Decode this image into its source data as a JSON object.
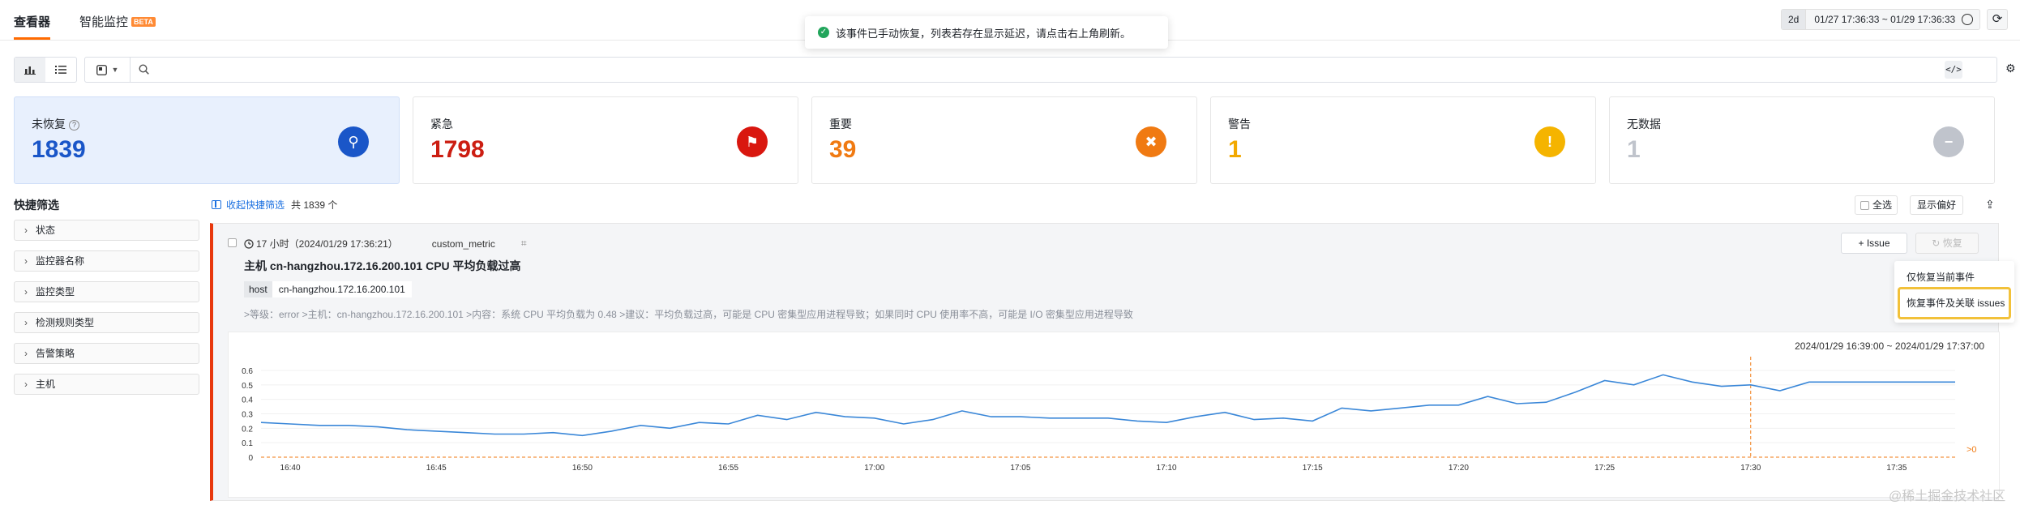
{
  "tabs": [
    {
      "label": "查看器"
    },
    {
      "label": "智能监控",
      "badge": "BETA"
    }
  ],
  "toast": {
    "message": "该事件已手动恢复，列表若存在显示延迟，请点击右上角刷新。"
  },
  "time": {
    "period": "2d",
    "range": "01/27 17:36:33 ~ 01/29 17:36:33"
  },
  "search": {
    "value": "",
    "code_label": "</>"
  },
  "cards": [
    {
      "label": "未恢复",
      "value": "1839",
      "color": "#1a56c8",
      "icon_color": "#1a56c8",
      "icon": "wrench-icon",
      "glyph": "⚲"
    },
    {
      "label": "紧急",
      "value": "1798",
      "color": "#cc1e12",
      "icon_color": "#d9170f",
      "icon": "siren-icon",
      "glyph": "⚑"
    },
    {
      "label": "重要",
      "value": "39",
      "color": "#f07a12",
      "icon_color": "#f07a12",
      "icon": "cross-icon",
      "glyph": "✖"
    },
    {
      "label": "警告",
      "value": "1",
      "color": "#f2a900",
      "icon_color": "#f5b400",
      "icon": "exclamation-icon",
      "glyph": "!"
    },
    {
      "label": "无数据",
      "value": "1",
      "color": "#c0c4cc",
      "icon_color": "#c0c4cc",
      "icon": "minus-icon",
      "glyph": "−"
    }
  ],
  "quick_filter": {
    "title": "快捷筛选",
    "items": [
      "状态",
      "监控器名称",
      "监控类型",
      "检测规则类型",
      "告警策略",
      "主机"
    ]
  },
  "list_header": {
    "collapse_label": "收起快捷筛选",
    "total_label": "共 1839 个",
    "select_all_label": "全选",
    "display_pref_label": "显示偏好"
  },
  "event": {
    "time_label": "17 小时（2024/01/29 17:36:21）",
    "metric": "custom_metric",
    "title": "主机 cn-hangzhou.172.16.200.101 CPU 平均负载过高",
    "tag_key": "host",
    "tag_value": "cn-hangzhou.172.16.200.101",
    "description": ">等级：error >主机：cn-hangzhou.172.16.200.101 >内容：系统 CPU 平均负载为 0.48 >建议：平均负载过高，可能是 CPU 密集型应用进程导致；如果同时 CPU 使用率不高，可能是 I/O 密集型应用进程导致",
    "issue_label": "+ Issue",
    "recover_label": "恢复",
    "dropdown": [
      "仅恢复当前事件",
      "恢复事件及关联 issues"
    ]
  },
  "chart_data": {
    "type": "line",
    "range_label": "2024/01/29 16:39:00 ~ 2024/01/29 17:37:00",
    "x_ticks": [
      "16:40",
      "16:45",
      "16:50",
      "16:55",
      "17:00",
      "17:05",
      "17:10",
      "17:15",
      "17:20",
      "17:25",
      "17:30",
      "17:35"
    ],
    "y_ticks": [
      "0",
      "0.1",
      "0.2",
      "0.3",
      "0.4",
      "0.5",
      "0.6"
    ],
    "ylim": [
      0,
      0.6
    ],
    "threshold_label": ">0",
    "series": [
      {
        "color": "#3a87d8",
        "x": [
          "16:39",
          "16:40",
          "16:41",
          "16:42",
          "16:43",
          "16:44",
          "16:45",
          "16:46",
          "16:47",
          "16:48",
          "16:49",
          "16:50",
          "16:51",
          "16:52",
          "16:53",
          "16:54",
          "16:55",
          "16:56",
          "16:57",
          "16:58",
          "16:59",
          "17:00",
          "17:01",
          "17:02",
          "17:03",
          "17:04",
          "17:05",
          "17:06",
          "17:07",
          "17:08",
          "17:09",
          "17:10",
          "17:11",
          "17:12",
          "17:13",
          "17:14",
          "17:15",
          "17:16",
          "17:17",
          "17:18",
          "17:19",
          "17:20",
          "17:21",
          "17:22",
          "17:23",
          "17:24",
          "17:25",
          "17:26",
          "17:27",
          "17:28",
          "17:29",
          "17:30",
          "17:31",
          "17:32",
          "17:33",
          "17:34",
          "17:35",
          "17:36",
          "17:37"
        ],
        "values": [
          0.24,
          0.23,
          0.22,
          0.22,
          0.21,
          0.19,
          0.18,
          0.17,
          0.16,
          0.16,
          0.17,
          0.15,
          0.18,
          0.22,
          0.2,
          0.24,
          0.23,
          0.29,
          0.26,
          0.31,
          0.28,
          0.27,
          0.23,
          0.26,
          0.32,
          0.28,
          0.28,
          0.27,
          0.27,
          0.27,
          0.25,
          0.24,
          0.28,
          0.31,
          0.26,
          0.27,
          0.25,
          0.34,
          0.32,
          0.34,
          0.36,
          0.36,
          0.42,
          0.37,
          0.38,
          0.45,
          0.53,
          0.5,
          0.57,
          0.52,
          0.49,
          0.5,
          0.46,
          0.52,
          0.52,
          0.52,
          0.52,
          0.52,
          0.52
        ]
      }
    ],
    "marker_x": "17:30",
    "threshold_color": "#f07a12"
  },
  "watermark": "@稀土掘金技术社区"
}
